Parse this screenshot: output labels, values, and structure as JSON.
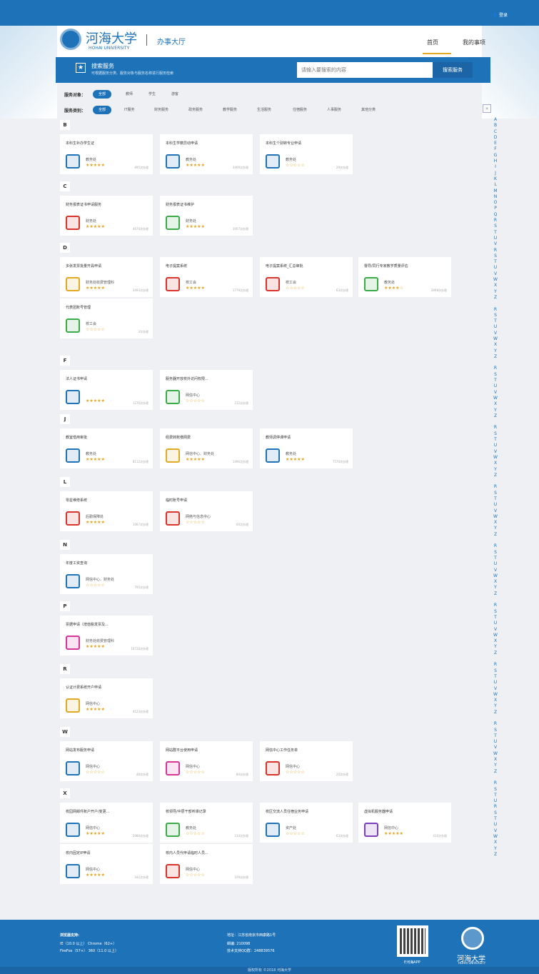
{
  "topbar": {
    "login": "登录"
  },
  "header": {
    "brand": "河海大学",
    "brand_en": "HOHAI UNIVERSITY",
    "hall": "办事大厅",
    "nav": [
      "首页",
      "我的事项"
    ]
  },
  "search": {
    "title": "搜索服务",
    "subtitle": "可根据服务分类、服务对象与服务名称进行服务检索",
    "placeholder": "请输入要搜索的内容",
    "button": "搜索服务"
  },
  "filters": {
    "audience_label": "服务对象：",
    "audience": [
      "全部",
      "教师",
      "学生",
      "游客"
    ],
    "category_label": "服务类别：",
    "category": [
      "全部",
      "IT服务",
      "财务服务",
      "政务服务",
      "教学服务",
      "生活服务",
      "住宿服务",
      "人事服务",
      "其他分类"
    ]
  },
  "colors": {
    "primary": "#1e73b8",
    "accent": "#e3a925",
    "star": "#e6a21c"
  },
  "sections": [
    {
      "letter": "B",
      "cards": [
        {
          "title": "本科生补办学生证",
          "dept": "教务处",
          "stars": "★★★★★",
          "count": "895次办理",
          "icon": "id-card-icon",
          "color": "#1e73b8"
        },
        {
          "title": "本科生学籍异动申请",
          "dept": "教务处",
          "stars": "★★★★★",
          "count": "3469次办理",
          "icon": "person-doc-icon",
          "color": "#1e73b8"
        },
        {
          "title": "本科生个别转专业申请",
          "dept": "教务处",
          "stars": "☆☆☆☆☆",
          "count": "29次办理",
          "icon": "document-icon",
          "color": "#1e73b8"
        }
      ]
    },
    {
      "letter": "C",
      "cards": [
        {
          "title": "财务报表证书申请服务",
          "dept": "财务处",
          "stars": "★★★★★",
          "count": "4470次办理",
          "icon": "certificate-icon",
          "color": "#d9342b"
        },
        {
          "title": "财务报表证书维护",
          "dept": "财务处",
          "stars": "★★★★★",
          "count": "1007次办理",
          "icon": "award-icon",
          "color": "#3bab4a"
        }
      ]
    },
    {
      "letter": "D",
      "cards": [
        {
          "title": "多张发票批量开具申请",
          "dept": "财务处收费管理科",
          "stars": "★★★★★",
          "count": "2493次办理",
          "icon": "invoice-icon",
          "color": "#e3a925"
        },
        {
          "title": "电子提案系统",
          "dept": "校工会",
          "stars": "★★★★★",
          "count": "1779次办理",
          "icon": "proposal-icon",
          "color": "#d9342b"
        },
        {
          "title": "电子提案系统_汇总审批",
          "dept": "校工会",
          "stars": "☆☆☆☆☆",
          "count": "63次办理",
          "icon": "medical-plus-icon",
          "color": "#d9342b"
        },
        {
          "title": "督导/同行专家教学质量评估",
          "dept": "教务处",
          "stars": "★★★★☆",
          "count": "2898次办理",
          "icon": "teacher-icon",
          "color": "#3bab4a"
        },
        {
          "title": "代表团账号管理",
          "dept": "校工会",
          "stars": "☆☆☆☆☆",
          "count": "3次办理",
          "icon": "user-manage-icon",
          "color": "#3bab4a"
        }
      ]
    },
    {
      "letter": "F",
      "cards": [
        {
          "title": "法人证书申请",
          "dept": "",
          "stars": "★★★★★",
          "count": "1270次办理",
          "icon": "legal-cert-icon",
          "color": "#1e73b8"
        },
        {
          "title": "服务器开放校外访问权限...",
          "dept": "网信中心",
          "stars": "☆☆☆☆☆",
          "count": "212次办理",
          "icon": "network-icon",
          "color": "#3bab4a"
        }
      ]
    },
    {
      "letter": "J",
      "cards": [
        {
          "title": "教室借用审批",
          "dept": "教务处",
          "stars": "★★★★★",
          "count": "8112次办理",
          "icon": "house-clock-icon",
          "color": "#1e73b8"
        },
        {
          "title": "经费转账缴网费",
          "dept": "网信中心、财务处",
          "stars": "★★★★★",
          "count": "1496次办理",
          "icon": "money-icon",
          "color": "#e3a925"
        },
        {
          "title": "教师调停课申请",
          "dept": "教务处",
          "stars": "★★★★★",
          "count": "7570次办理",
          "icon": "calendar-icon",
          "color": "#1e73b8"
        }
      ]
    },
    {
      "letter": "L",
      "cards": [
        {
          "title": "零星维修系统",
          "dept": "后勤保障处",
          "stars": "★★★★★",
          "count": "1067次办理",
          "icon": "building-icon",
          "color": "#d9342b"
        },
        {
          "title": "临时账号申请",
          "dept": "网络与信息中心",
          "stars": "☆☆☆☆☆",
          "count": "60次办理",
          "icon": "temp-account-icon",
          "color": "#d9342b"
        }
      ]
    },
    {
      "letter": "N",
      "cards": [
        {
          "title": "年度工资查询",
          "dept": "网信中心、财务处",
          "stars": "☆☆☆☆☆",
          "count": "795次办理",
          "icon": "graduate-icon",
          "color": "#1e73b8"
        }
      ]
    },
    {
      "letter": "P",
      "cards": [
        {
          "title": "票据申请（增值税发票及...",
          "dept": "财务处收费管理科",
          "stars": "★★★★★",
          "count": "10726次办理",
          "icon": "receipt-icon",
          "color": "#d93596"
        }
      ]
    },
    {
      "letter": "R",
      "cards": [
        {
          "title": "认证计费系统开户申请",
          "dept": "网信中心",
          "stars": "★★★★★",
          "count": "4123次办理",
          "icon": "card-plus-icon",
          "color": "#e3a925"
        }
      ]
    },
    {
      "letter": "W",
      "cards": [
        {
          "title": "网站发布服务申请",
          "dept": "网信中心",
          "stars": "☆☆☆☆☆",
          "count": "48次办理",
          "icon": "website-gear-icon",
          "color": "#1e73b8"
        },
        {
          "title": "网站群平台使用申请",
          "dept": "网信中心",
          "stars": "☆☆☆☆☆",
          "count": "80次办理",
          "icon": "share-icon",
          "color": "#d93596"
        },
        {
          "title": "网信中心工作任务单",
          "dept": "网信中心",
          "stars": "☆☆☆☆☆",
          "count": "20次办理",
          "icon": "task-list-icon",
          "color": "#d9342b"
        }
      ]
    },
    {
      "letter": "X",
      "cards": [
        {
          "title": "校园网邮件账户开户/变更...",
          "dept": "网信中心",
          "stars": "★★★★★",
          "count": "2980次办理",
          "icon": "mail-icon",
          "color": "#1e73b8"
        },
        {
          "title": "校领导/中层干部听课记录",
          "dept": "教务处",
          "stars": "☆☆☆☆☆",
          "count": "134次办理",
          "icon": "listener-icon",
          "color": "#3bab4a"
        },
        {
          "title": "校区交流人员住宿业务申请",
          "dept": "资产处",
          "stars": "☆☆☆☆☆",
          "count": "63次办理",
          "icon": "dorm-icon",
          "color": "#1e73b8"
        },
        {
          "title": "虚拟机服务器申请",
          "dept": "网信中心",
          "stars": "★★★★★",
          "count": "410次办理",
          "icon": "cloud-icon",
          "color": "#7b3fb8"
        },
        {
          "title": "校内固定IP申请",
          "dept": "网信中心",
          "stars": "★★★★★",
          "count": "342次办理",
          "icon": "ip-icon",
          "color": "#1e73b8"
        },
        {
          "title": "校内人员代申请临时人员...",
          "dept": "网信中心",
          "stars": "☆☆☆☆☆",
          "count": "109次办理",
          "icon": "temp-person-icon",
          "color": "#d9342b"
        }
      ]
    }
  ],
  "az": [
    "A",
    "B",
    "C",
    "D",
    "E",
    "F",
    "G",
    "H",
    "I",
    "J",
    "K",
    "L",
    "M",
    "N",
    "O",
    "P",
    "Q",
    "R",
    "S",
    "T",
    "U",
    "V",
    "R",
    "S",
    "T",
    "U",
    "V",
    "W",
    "X",
    "Y",
    "Z",
    "",
    "R",
    "S",
    "T",
    "U",
    "V",
    "W",
    "X",
    "Y",
    "Z",
    "",
    "R",
    "S",
    "T",
    "U",
    "V",
    "W",
    "X",
    "Y",
    "Z",
    "",
    "R",
    "S",
    "T",
    "U",
    "V",
    "W",
    "X",
    "Y",
    "Z",
    "",
    "R",
    "S",
    "T",
    "U",
    "V",
    "W",
    "X",
    "Y",
    "Z",
    "",
    "R",
    "S",
    "T",
    "U",
    "V",
    "W",
    "X",
    "Y",
    "Z",
    "",
    "R",
    "S",
    "T",
    "U",
    "V",
    "W",
    "X",
    "Y",
    "Z",
    "",
    "R",
    "S",
    "T",
    "U",
    "V",
    "W",
    "X",
    "Y",
    "Z",
    "",
    "R",
    "S",
    "T",
    "U",
    "V",
    "W",
    "X",
    "Y",
    "Z",
    "",
    "R",
    "S",
    "T",
    "U",
    "R",
    "S",
    "T",
    "U",
    "V",
    "W",
    "X",
    "Y",
    "Z"
  ],
  "footer": {
    "browser_title": "浏览器支持:",
    "browser_1": "IE（10.0 以上） Chrome（62+）",
    "browser_2": "FireFox（57+） 360（11.0 以上）",
    "address": "地址：江苏省南京市西康路1号",
    "postcode": "邮编: 210098",
    "qq": "技术支持QQ群：248839576",
    "app": "E河海APP",
    "brand": "河海大学",
    "brand_en": "HOHAI UNIVERSITY",
    "copyright": "版权所有 ©2018 河海大学"
  }
}
